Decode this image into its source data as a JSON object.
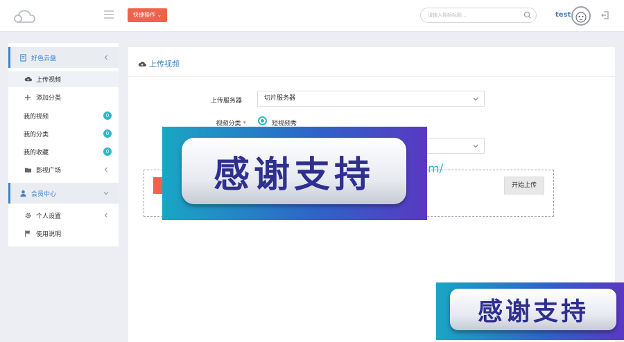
{
  "header": {
    "quick_action_label": "快捷操作 ⌄",
    "search_placeholder": "请输入视频标题...",
    "username": "test"
  },
  "sidebar": {
    "group1": {
      "label": "好色云盘",
      "items": [
        {
          "label": "上传视频",
          "icon": "cloud-upload-icon"
        },
        {
          "label": "添加分类",
          "icon": "plus-icon"
        },
        {
          "label": "我的视频",
          "badge": "0"
        },
        {
          "label": "我的分类",
          "badge": "0"
        },
        {
          "label": "我的收藏",
          "badge": "0"
        },
        {
          "label": "影视广场",
          "icon": "folder-open-icon"
        }
      ]
    },
    "group2": {
      "label": "会员中心",
      "items": [
        {
          "label": "个人设置",
          "icon": "gear-icon"
        },
        {
          "label": "使用说明",
          "icon": "flag-icon"
        }
      ]
    }
  },
  "main": {
    "title": "上传视频",
    "upload_server_label": "上传服务器",
    "upload_server_value": "切片服务器",
    "category_label": "视频分类",
    "category_option": "短视频秀",
    "url_fragment": "m/",
    "start_upload_label": "开始上传"
  },
  "overlay": {
    "banner_text": "感谢支持"
  },
  "colors": {
    "accent": "#3e85c6",
    "quick_action": "#f0624a",
    "badge": "#2fb8c6"
  }
}
